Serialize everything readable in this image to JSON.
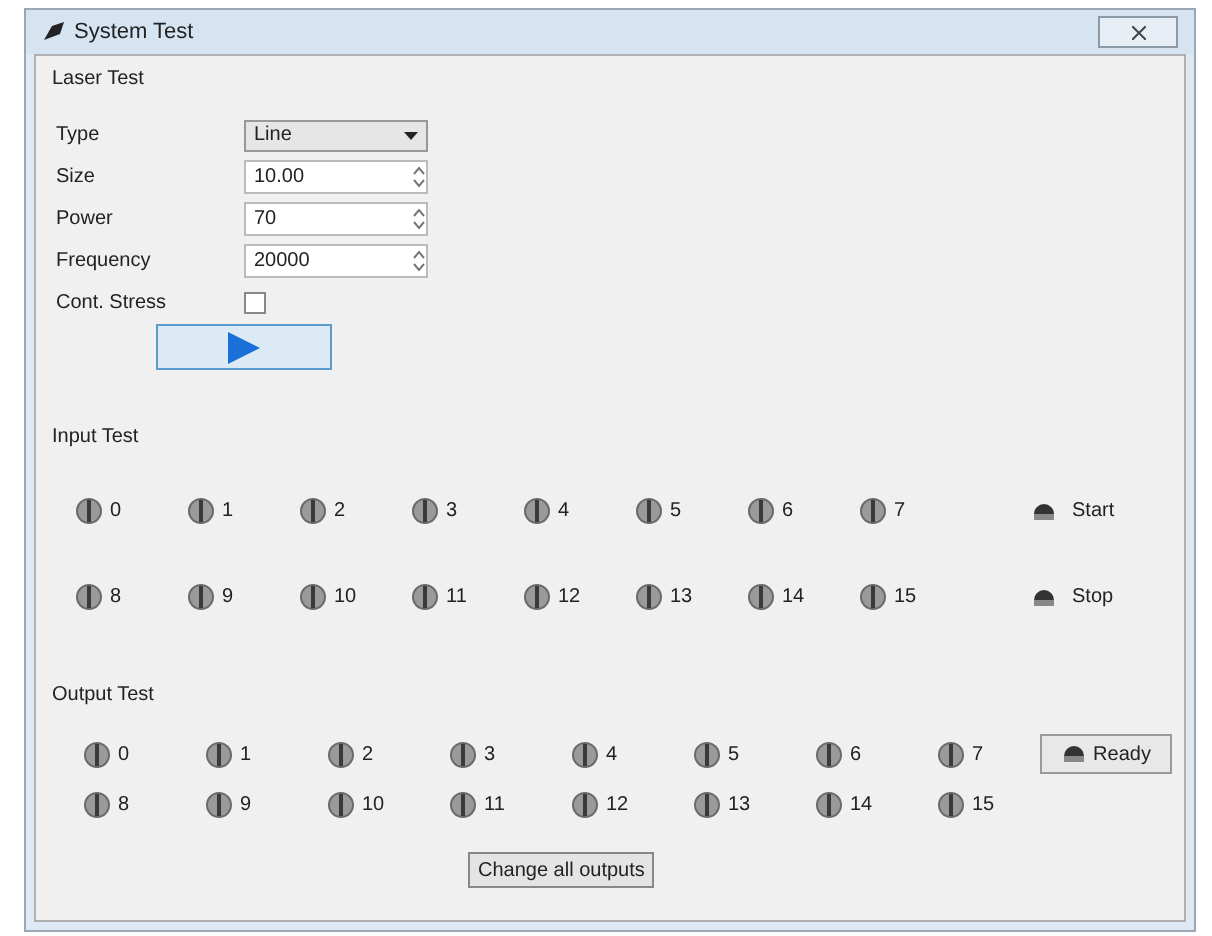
{
  "window": {
    "title": "System Test"
  },
  "laser_test": {
    "title": "Laser Test",
    "fields": [
      {
        "kind": "select",
        "label": "Type",
        "value": "Line"
      },
      {
        "kind": "spin",
        "label": "Size",
        "value": "10.00"
      },
      {
        "kind": "spin",
        "label": "Power",
        "value": "70"
      },
      {
        "kind": "spin",
        "label": "Frequency",
        "value": "20000"
      },
      {
        "kind": "checkbox",
        "label": "Cont. Stress",
        "checked": false
      }
    ]
  },
  "input_test": {
    "title": "Input Test",
    "inputs": [
      "0",
      "1",
      "2",
      "3",
      "4",
      "5",
      "6",
      "7",
      "8",
      "9",
      "10",
      "11",
      "12",
      "13",
      "14",
      "15"
    ],
    "start": "Start",
    "stop": "Stop"
  },
  "output_test": {
    "title": "Output Test",
    "outputs": [
      "0",
      "1",
      "2",
      "3",
      "4",
      "5",
      "6",
      "7",
      "8",
      "9",
      "10",
      "11",
      "12",
      "13",
      "14",
      "15"
    ],
    "ready": "Ready",
    "change_all": "Change all outputs"
  }
}
